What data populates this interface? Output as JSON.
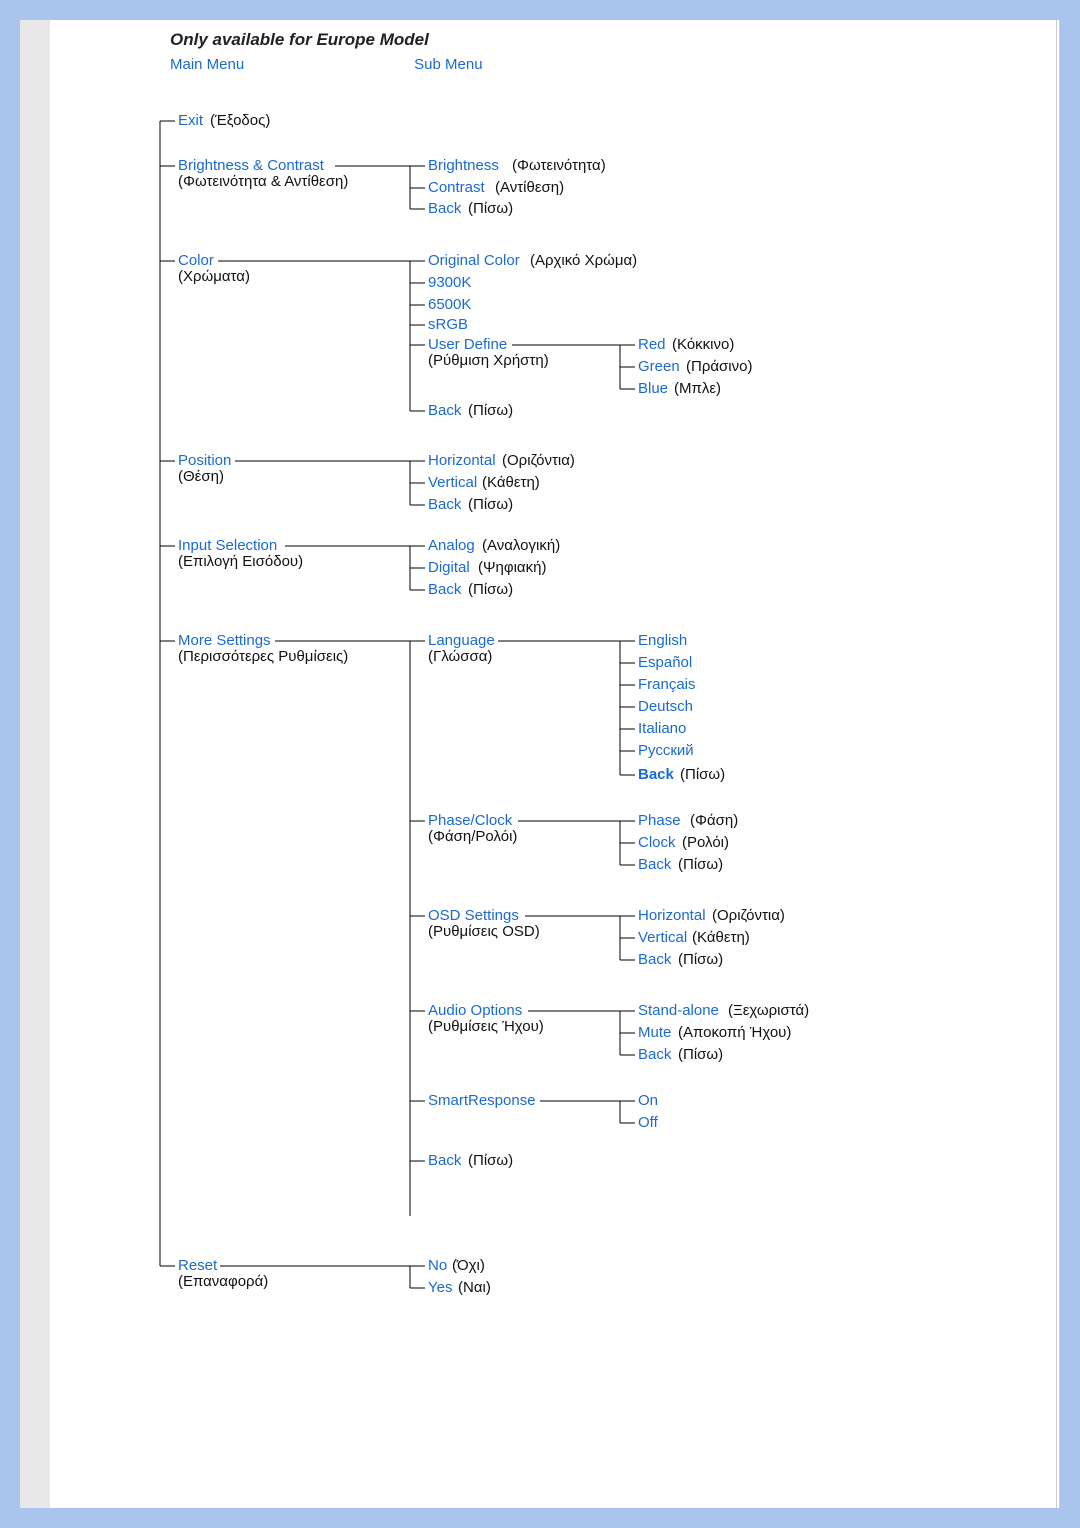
{
  "note": "Only available for Europe Model",
  "header_main": "Main Menu",
  "header_sub": "Sub Menu",
  "exit": {
    "en": "Exit",
    "gr": "(Έξοδος)"
  },
  "bc": {
    "en": "Brightness &  Contrast",
    "gr": "(Φωτεινότητα & Αντίθεση)",
    "brightness": {
      "en": "Brightness",
      "gr": "(Φωτεινότητα)"
    },
    "contrast": {
      "en": "Contrast",
      "gr": "(Αντίθεση)"
    },
    "back": {
      "en": "Back",
      "gr": "(Πίσω)"
    }
  },
  "color": {
    "en": "Color",
    "gr": "(Χρώματα)",
    "orig": {
      "en": "Original Color",
      "gr": "(Αρχικό Χρώμα)"
    },
    "k93": "9300K",
    "k65": "6500K",
    "srgb": "sRGB",
    "user": {
      "en": "User Define",
      "gr": "(Ρύθμιση Χρήστη)",
      "red": {
        "en": "Red",
        "gr": "(Κόκκινο)"
      },
      "green": {
        "en": "Green",
        "gr": "(Πράσινο)"
      },
      "blue": {
        "en": "Blue",
        "gr": "(Μπλε)"
      }
    },
    "back": {
      "en": "Back",
      "gr": "(Πίσω)"
    }
  },
  "pos": {
    "en": "Position",
    "gr": "(Θέση)",
    "h": {
      "en": "Horizontal",
      "gr": "(Οριζόντια)"
    },
    "v": {
      "en": "Vertical",
      "gr": "(Κάθετη)"
    },
    "back": {
      "en": "Back",
      "gr": "(Πίσω)"
    }
  },
  "input": {
    "en": "Input Selection",
    "gr": "(Επιλογή Εισόδου)",
    "analog": {
      "en": "Analog",
      "gr": "(Αναλογική)"
    },
    "digital": {
      "en": "Digital",
      "gr": "(Ψηφιακή)"
    },
    "back": {
      "en": "Back",
      "gr": "(Πίσω)"
    }
  },
  "more": {
    "en": "More Settings",
    "gr": "(Περισσότερες Ρυθμίσεις)",
    "lang": {
      "en": "Language",
      "gr": "(Γλώσσα)",
      "english": "English",
      "espanol": "Español",
      "francais": "Français",
      "deutsch": "Deutsch",
      "italiano": "Italiano",
      "russian": "Русский",
      "back": {
        "en": "Back",
        "gr": "(Πίσω)"
      }
    },
    "phase": {
      "en": "Phase/Clock",
      "gr": "(Φάση/Ρολόι)",
      "p": {
        "en": "Phase",
        "gr": "(Φάση)"
      },
      "c": {
        "en": "Clock",
        "gr": "(Ρολόι)"
      },
      "back": {
        "en": "Back",
        "gr": "(Πίσω)"
      }
    },
    "osd": {
      "en": "OSD Settings",
      "gr": "(Ρυθμίσεις OSD)",
      "h": {
        "en": "Horizontal",
        "gr": "(Οριζόντια)"
      },
      "v": {
        "en": "Vertical",
        "gr": "(Κάθετη)"
      },
      "back": {
        "en": "Back",
        "gr": "(Πίσω)"
      }
    },
    "audio": {
      "en": "Audio Options",
      "gr": "(Ρυθμίσεις Ήχου)",
      "stand": {
        "en": "Stand-alone",
        "gr": "(Ξεχωριστά)"
      },
      "mute": {
        "en": "Mute",
        "gr": "(Αποκοπή Ήχου)"
      },
      "back": {
        "en": "Back",
        "gr": "(Πίσω)"
      }
    },
    "smart": {
      "en": "SmartResponse",
      "on": "On",
      "off": "Off"
    },
    "back": {
      "en": "Back",
      "gr": "(Πίσω)"
    }
  },
  "reset": {
    "en": "Reset",
    "gr": "(Επαναφορά)",
    "no": {
      "en": "No",
      "gr": "(Όχι)"
    },
    "yes": {
      "en": "Yes",
      "gr": "(Ναι)"
    }
  }
}
